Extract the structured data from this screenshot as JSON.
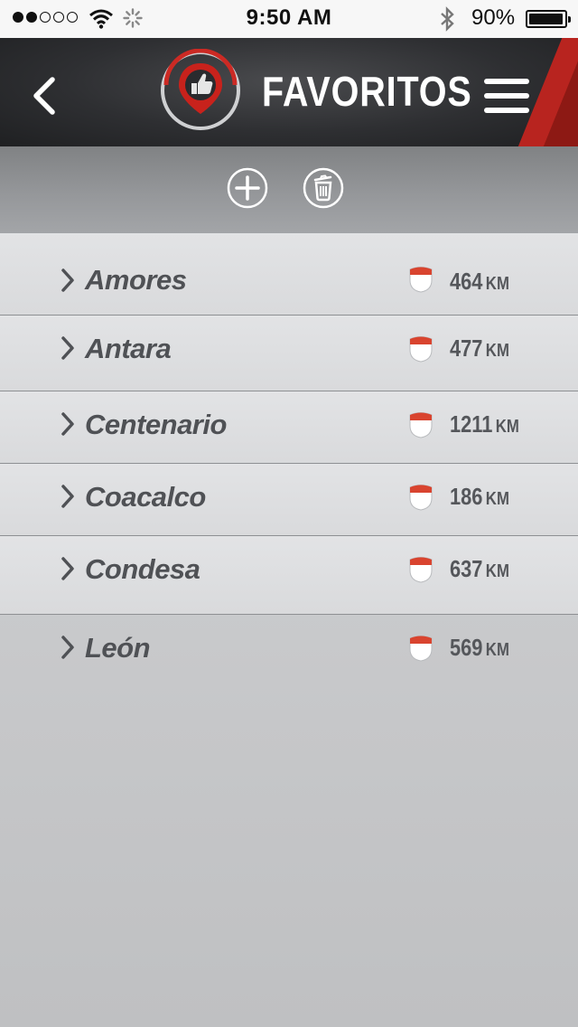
{
  "status_bar": {
    "signal_dots_filled": 2,
    "signal_dots_total": 5,
    "time": "9:50 AM",
    "battery_text": "90%",
    "battery_level": 0.9,
    "icons": [
      "wifi-icon",
      "activity-spinner-icon",
      "bluetooth-icon",
      "battery-icon"
    ]
  },
  "header": {
    "title": "FAVORITOS",
    "icons": [
      "back-chevron-icon",
      "thumbs-up-pin-logo",
      "hamburger-menu-icon"
    ],
    "accent_color": "#b8241f"
  },
  "toolbar": {
    "icons": [
      "plus-circle-icon",
      "trash-circle-icon"
    ]
  },
  "favorites": [
    {
      "name": "Amores",
      "distance": "464",
      "unit": "KM"
    },
    {
      "name": "Antara",
      "distance": "477",
      "unit": "KM"
    },
    {
      "name": "Centenario",
      "distance": "1211",
      "unit": "KM"
    },
    {
      "name": "Coacalco",
      "distance": "186",
      "unit": "KM"
    },
    {
      "name": "Condesa",
      "distance": "637",
      "unit": "KM"
    },
    {
      "name": "León",
      "distance": "569",
      "unit": "KM"
    }
  ]
}
